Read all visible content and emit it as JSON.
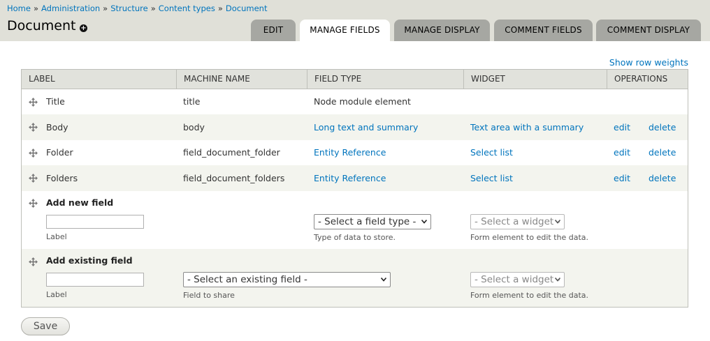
{
  "breadcrumb": {
    "items": [
      "Home",
      "Administration",
      "Structure",
      "Content types",
      "Document"
    ],
    "separator": "»"
  },
  "page": {
    "title": "Document"
  },
  "tabs": [
    {
      "label": "EDIT",
      "active": false
    },
    {
      "label": "MANAGE FIELDS",
      "active": true
    },
    {
      "label": "MANAGE DISPLAY",
      "active": false
    },
    {
      "label": "COMMENT FIELDS",
      "active": false
    },
    {
      "label": "COMMENT DISPLAY",
      "active": false
    }
  ],
  "show_row_weights": "Show row weights",
  "table": {
    "headers": [
      "LABEL",
      "MACHINE NAME",
      "FIELD TYPE",
      "WIDGET",
      "OPERATIONS"
    ],
    "rows": [
      {
        "label": "Title",
        "machine_name": "title",
        "field_type": "Node module element",
        "widget": "",
        "edit": "",
        "delete": ""
      },
      {
        "label": "Body",
        "machine_name": "body",
        "field_type": "Long text and summary",
        "widget": "Text area with a summary",
        "edit": "edit",
        "delete": "delete"
      },
      {
        "label": "Folder",
        "machine_name": "field_document_folder",
        "field_type": "Entity Reference",
        "widget": "Select list",
        "edit": "edit",
        "delete": "delete"
      },
      {
        "label": "Folders",
        "machine_name": "field_document_folders",
        "field_type": "Entity Reference",
        "widget": "Select list",
        "edit": "edit",
        "delete": "delete"
      }
    ]
  },
  "add_new_field": {
    "heading": "Add new field",
    "label_value": "",
    "label_desc": "Label",
    "field_type_select": "- Select a field type -",
    "field_type_desc": "Type of data to store.",
    "widget_select": "- Select a widget -",
    "widget_desc": "Form element to edit the data."
  },
  "add_existing_field": {
    "heading": "Add existing field",
    "label_value": "",
    "label_desc": "Label",
    "existing_select": "- Select an existing field -",
    "existing_desc": "Field to share",
    "widget_select": "- Select a widget -",
    "widget_desc": "Form element to edit the data."
  },
  "save_label": "Save",
  "colors": {
    "link": "#0074bd",
    "header_bg": "#e0e0d8",
    "tab_bg": "#a6a7a2",
    "row_alt": "#f3f4ee"
  }
}
